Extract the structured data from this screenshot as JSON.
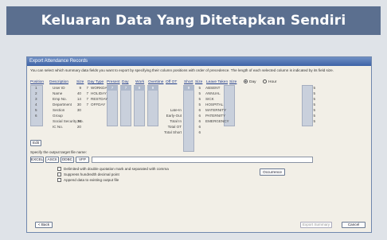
{
  "banner": {
    "title": "Keluaran Data Yang Ditetapkan Sendiri"
  },
  "dialog": {
    "title": "Export Attendance Records",
    "description": "You can select which summary data fields you want to export by specifying their column positions with order of  precedence. The length of each selected column is indicated by its field size.",
    "headers": {
      "position": "Position",
      "description": "Description",
      "size": "Size",
      "daytype": "Day Type",
      "present": "Present",
      "day": "Day",
      "work": "Work",
      "overtime": "Overtime",
      "offot": "Off OT",
      "short": "Short",
      "size2": "Size",
      "leave": "Leave Taken",
      "size3": "Size"
    },
    "fields": [
      {
        "pos": "1",
        "name": "User ID",
        "size": "9"
      },
      {
        "pos": "2",
        "name": "Name",
        "size": "40"
      },
      {
        "pos": "3",
        "name": "Emp No.",
        "size": "14"
      },
      {
        "pos": "4",
        "name": "Department",
        "size": "30"
      },
      {
        "pos": "5",
        "name": "Section",
        "size": "30"
      },
      {
        "pos": "6",
        "name": "Group",
        "size": ""
      },
      {
        "pos": "",
        "name": "Social Security No.",
        "size": "20"
      },
      {
        "pos": "",
        "name": "IC No.",
        "size": "20"
      }
    ],
    "daytypes": [
      "WORKDAY",
      "HOLIDAY",
      "RESTDAY",
      "OFFDAY"
    ],
    "daytype_sizes": [
      "7",
      "7",
      "7",
      "7"
    ],
    "chips": {
      "present": "7",
      "day": "7",
      "work": "8",
      "overtime": "9",
      "short": "9"
    },
    "totals": [
      {
        "label": "Late-In",
        "size": "6"
      },
      {
        "label": "Early-Out",
        "size": "6"
      },
      {
        "label": "Total In",
        "size": "6"
      },
      {
        "label": "Total OT",
        "size": "6"
      },
      {
        "label": "Total Short",
        "size": "6"
      }
    ],
    "leaves": [
      "ABSENT",
      "ANNUAL",
      "SICK",
      "HOSPITAL",
      "MATERNITY",
      "PATERNITY",
      "EMERGENCY"
    ],
    "leave_sizes": [
      "5",
      "5",
      "5",
      "5",
      "5",
      "5",
      "5"
    ],
    "right_sizes": [
      "5",
      "5",
      "5",
      "5",
      "5",
      "5",
      "5"
    ],
    "radio": {
      "day": "Day",
      "hour": "Hour"
    },
    "edit_label": "Edit",
    "filename_label": "Specify the output target file name:",
    "formats": [
      "EXCEL",
      "ASCII",
      "DDBC",
      "VFP"
    ],
    "checks": [
      "Delimited with double quotation mark and separated with comma",
      "Suppress hundredth decimal point",
      "Append data to existing output file"
    ],
    "occurrence_label": "Occurrence",
    "back_label": "< Back",
    "export_label": "Export Summary",
    "cancel_label": "Cancel"
  }
}
